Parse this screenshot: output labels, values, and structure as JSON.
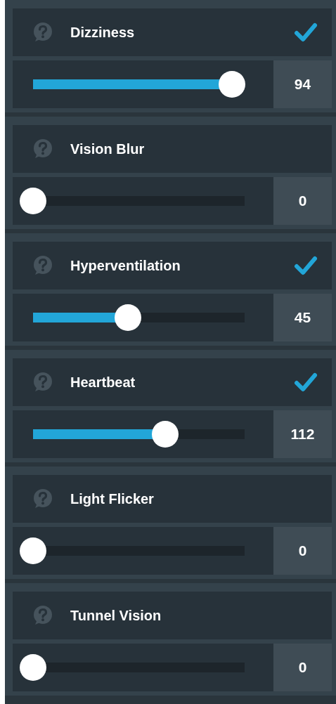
{
  "symptoms": [
    {
      "name": "Dizziness",
      "checked": true,
      "level": 0.94,
      "value": "94"
    },
    {
      "name": "Vision Blur",
      "checked": false,
      "level": 0,
      "value": "0"
    },
    {
      "name": "Hyperventilation",
      "checked": true,
      "level": 0.45,
      "value": "45"
    },
    {
      "name": "Heartbeat",
      "checked": true,
      "level": 0.625,
      "value": "112"
    },
    {
      "name": "Light Flicker",
      "checked": false,
      "level": 0,
      "value": "0"
    },
    {
      "name": "Tunnel Vision",
      "checked": false,
      "level": 0,
      "value": "0"
    }
  ]
}
